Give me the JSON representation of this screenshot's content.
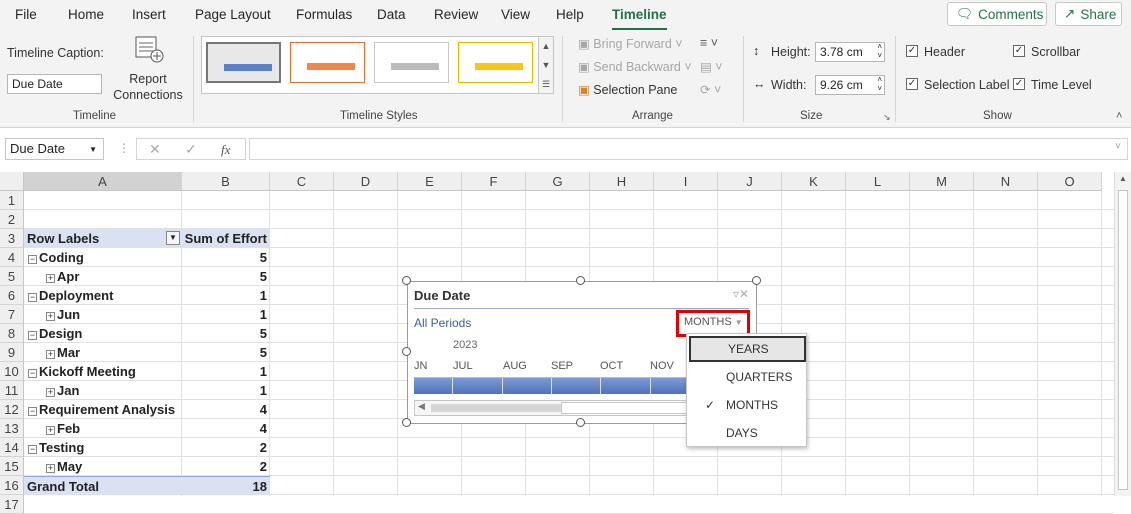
{
  "tabs": [
    "File",
    "Home",
    "Insert",
    "Page Layout",
    "Formulas",
    "Data",
    "Review",
    "View",
    "Help",
    "Timeline"
  ],
  "top_buttons": {
    "comments": "Comments",
    "share": "Share"
  },
  "ribbon": {
    "timeline_group": {
      "caption_label": "Timeline Caption:",
      "caption_value": "Due Date",
      "report_connections": "Report Connections",
      "label": "Timeline"
    },
    "styles_group": {
      "label": "Timeline Styles"
    },
    "arrange": {
      "bring_forward": "Bring Forward",
      "send_backward": "Send Backward",
      "selection_pane": "Selection Pane",
      "label": "Arrange"
    },
    "size": {
      "height_label": "Height:",
      "height_value": "3.78 cm",
      "width_label": "Width:",
      "width_value": "9.26 cm",
      "label": "Size"
    },
    "show": {
      "header": "Header",
      "scrollbar": "Scrollbar",
      "selection_label": "Selection Label",
      "time_level": "Time Level",
      "label": "Show"
    }
  },
  "formula_bar": {
    "name_box": "Due Date",
    "fx": "fx"
  },
  "columns": [
    "A",
    "B",
    "C",
    "D",
    "E",
    "F",
    "G",
    "H",
    "I",
    "J",
    "K",
    "L",
    "M",
    "N",
    "O"
  ],
  "rows": [
    "1",
    "2",
    "3",
    "4",
    "5",
    "6",
    "7",
    "8",
    "9",
    "10",
    "11",
    "12",
    "13",
    "14",
    "15",
    "16",
    "17"
  ],
  "pivot": {
    "header_a": "Row Labels",
    "header_b": "Sum of Effort",
    "rows": [
      {
        "label": "Coding",
        "value": "5",
        "level": 0
      },
      {
        "label": "Apr",
        "value": "5",
        "level": 1
      },
      {
        "label": "Deployment",
        "value": "1",
        "level": 0
      },
      {
        "label": "Jun",
        "value": "1",
        "level": 1
      },
      {
        "label": "Design",
        "value": "5",
        "level": 0
      },
      {
        "label": "Mar",
        "value": "5",
        "level": 1
      },
      {
        "label": "Kickoff Meeting",
        "value": "1",
        "level": 0
      },
      {
        "label": "Jan",
        "value": "1",
        "level": 1
      },
      {
        "label": "Requirement Analysis",
        "value": "4",
        "level": 0
      },
      {
        "label": "Feb",
        "value": "4",
        "level": 1
      },
      {
        "label": "Testing",
        "value": "2",
        "level": 0
      },
      {
        "label": "May",
        "value": "2",
        "level": 1
      }
    ],
    "total_label": "Grand Total",
    "total_value": "18"
  },
  "timeline": {
    "title": "Due Date",
    "all_periods": "All Periods",
    "level": "MONTHS",
    "year": "2023",
    "months": [
      "JN",
      "JUL",
      "AUG",
      "SEP",
      "OCT",
      "NOV"
    ]
  },
  "dropdown": {
    "items": [
      "YEARS",
      "QUARTERS",
      "MONTHS",
      "DAYS"
    ],
    "checked": "MONTHS",
    "hovered": "YEARS"
  },
  "colors": {
    "accent": "#217346",
    "timeline_bar": "#5b7fc6",
    "highlight": "#e00000",
    "pivot_header": "#d9e1f2"
  }
}
